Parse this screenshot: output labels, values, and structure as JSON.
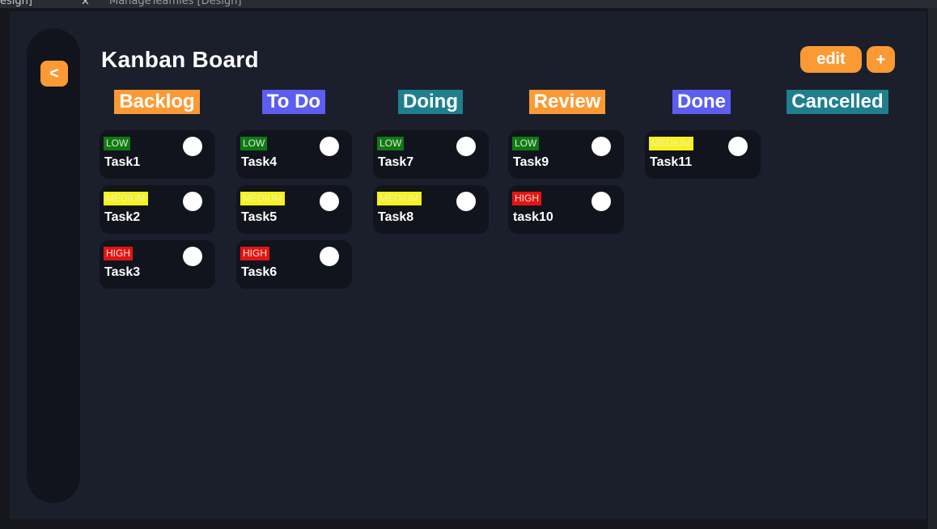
{
  "ide": {
    "left_text": "esign]",
    "close_glyph": "✕",
    "tab_title": "ManageTeamles [Design]"
  },
  "sidebar": {
    "back_label": "<"
  },
  "header": {
    "title": "Kanban Board",
    "edit_label": "edit",
    "add_label": "+"
  },
  "colors": {
    "orange": "#fb9a35",
    "blue": "#5b5ef0",
    "teal": "#1f7f8f",
    "low": "#0f7a12",
    "medium": "#f6f21a",
    "high": "#e11512"
  },
  "columns": [
    {
      "title": "Backlog",
      "color": "#fb9a35",
      "cards": [
        {
          "priority": "LOW",
          "name": "Task1"
        },
        {
          "priority": "MEDIUM",
          "name": "Task2"
        },
        {
          "priority": "HIGH",
          "name": "Task3"
        }
      ]
    },
    {
      "title": "To Do",
      "color": "#5b5ef0",
      "cards": [
        {
          "priority": "LOW",
          "name": "Task4"
        },
        {
          "priority": "MEDIUM",
          "name": "Task5"
        },
        {
          "priority": "HIGH",
          "name": "Task6"
        }
      ]
    },
    {
      "title": "Doing",
      "color": "#1f7f8f",
      "cards": [
        {
          "priority": "LOW",
          "name": "Task7"
        },
        {
          "priority": "MEDIUM",
          "name": "Task8"
        }
      ]
    },
    {
      "title": "Review",
      "color": "#fb9a35",
      "cards": [
        {
          "priority": "LOW",
          "name": "Task9"
        },
        {
          "priority": "HIGH",
          "name": "task10"
        }
      ]
    },
    {
      "title": "Done",
      "color": "#5b5ef0",
      "cards": [
        {
          "priority": "MEDIUM",
          "name": "Task11"
        }
      ]
    },
    {
      "title": "Cancelled",
      "color": "#1f7f8f",
      "cards": []
    }
  ]
}
